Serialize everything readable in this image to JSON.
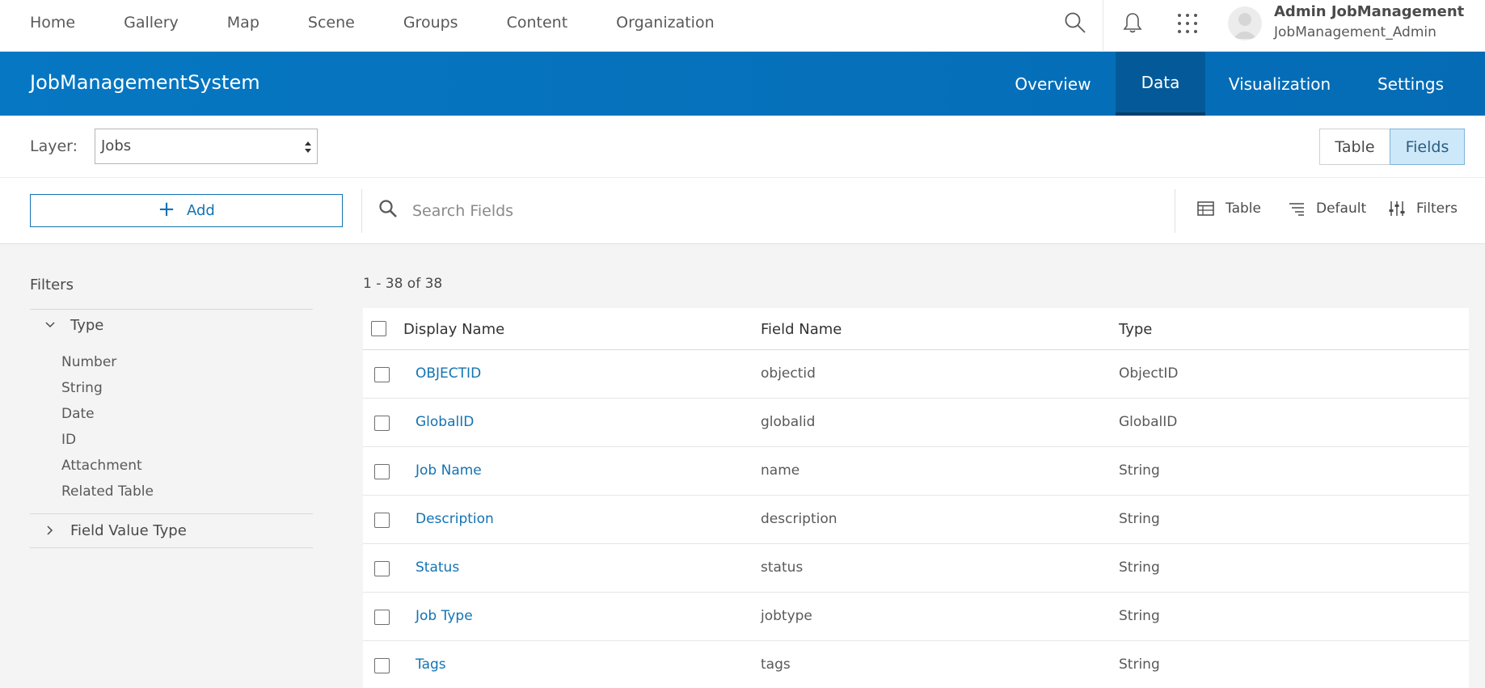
{
  "topnav": {
    "links": [
      "Home",
      "Gallery",
      "Map",
      "Scene",
      "Groups",
      "Content",
      "Organization"
    ],
    "user_name": "Admin JobManagement",
    "user_id": "JobManagement_Admin"
  },
  "app": {
    "title": "JobManagementSystem",
    "tabs": [
      "Overview",
      "Data",
      "Visualization",
      "Settings"
    ],
    "active_tab": "Data"
  },
  "layer": {
    "label": "Layer:",
    "selected": "Jobs",
    "views": [
      "Table",
      "Fields"
    ],
    "active_view": "Fields"
  },
  "toolbar": {
    "add_label": "Add",
    "search_placeholder": "Search Fields",
    "table_label": "Table",
    "sort_label": "Default",
    "filters_label": "Filters"
  },
  "filters": {
    "title": "Filters",
    "type_group": "Type",
    "type_options": [
      "Number",
      "String",
      "Date",
      "ID",
      "Attachment",
      "Related Table"
    ],
    "field_value_group": "Field Value Type"
  },
  "results": {
    "count": "1 - 38 of 38",
    "columns": [
      "Display Name",
      "Field Name",
      "Type"
    ],
    "rows": [
      {
        "display": "OBJECTID",
        "field": "objectid",
        "type": "ObjectID"
      },
      {
        "display": "GlobalID",
        "field": "globalid",
        "type": "GlobalID"
      },
      {
        "display": "Job Name",
        "field": "name",
        "type": "String"
      },
      {
        "display": "Description",
        "field": "description",
        "type": "String"
      },
      {
        "display": "Status",
        "field": "status",
        "type": "String"
      },
      {
        "display": "Job Type",
        "field": "jobtype",
        "type": "String"
      },
      {
        "display": "Tags",
        "field": "tags",
        "type": "String"
      }
    ]
  },
  "colors": {
    "brand_blue": "#0677c2",
    "active_tab": "#045a99",
    "link": "#1373b3",
    "active_segment": "#cde8f9"
  }
}
